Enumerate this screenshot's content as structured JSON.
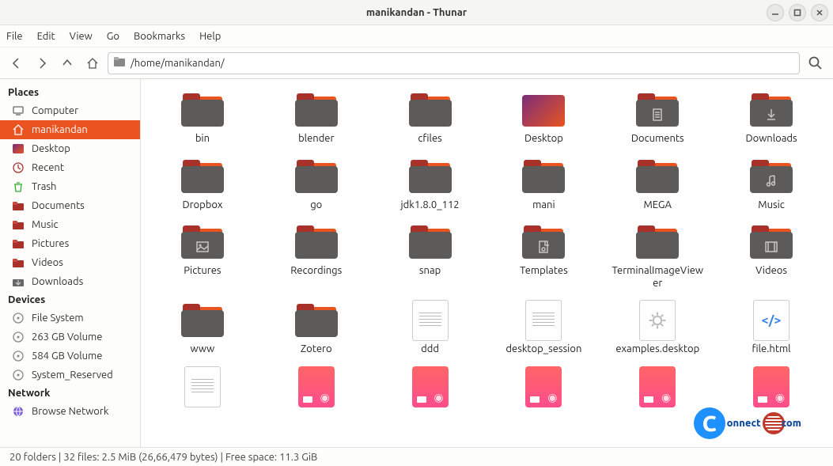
{
  "window": {
    "title": "manikandan - Thunar"
  },
  "menu": {
    "file": "File",
    "edit": "Edit",
    "view": "View",
    "go": "Go",
    "bookmarks": "Bookmarks",
    "help": "Help"
  },
  "toolbar": {
    "path": "/home/manikandan/"
  },
  "sidebar": {
    "places_header": "Places",
    "places": [
      {
        "label": "Computer",
        "icon": "computer"
      },
      {
        "label": "manikandan",
        "icon": "home",
        "active": true
      },
      {
        "label": "Desktop",
        "icon": "desktop"
      },
      {
        "label": "Recent",
        "icon": "recent"
      },
      {
        "label": "Trash",
        "icon": "trash"
      },
      {
        "label": "Documents",
        "icon": "folder-red"
      },
      {
        "label": "Music",
        "icon": "folder-red"
      },
      {
        "label": "Pictures",
        "icon": "folder-red"
      },
      {
        "label": "Videos",
        "icon": "folder-red"
      },
      {
        "label": "Downloads",
        "icon": "downloads"
      }
    ],
    "devices_header": "Devices",
    "devices": [
      {
        "label": "File System",
        "icon": "disk"
      },
      {
        "label": "263 GB Volume",
        "icon": "disk"
      },
      {
        "label": "584 GB Volume",
        "icon": "disk"
      },
      {
        "label": "System_Reserved",
        "icon": "disk"
      }
    ],
    "network_header": "Network",
    "network": [
      {
        "label": "Browse Network",
        "icon": "network"
      }
    ]
  },
  "items": [
    {
      "label": "bin",
      "type": "folder"
    },
    {
      "label": "blender",
      "type": "folder"
    },
    {
      "label": "cfiles",
      "type": "folder"
    },
    {
      "label": "Desktop",
      "type": "desktop"
    },
    {
      "label": "Documents",
      "type": "folder",
      "glyph": "doc"
    },
    {
      "label": "Downloads",
      "type": "folder",
      "glyph": "download"
    },
    {
      "label": "Dropbox",
      "type": "folder"
    },
    {
      "label": "go",
      "type": "folder"
    },
    {
      "label": "jdk1.8.0_112",
      "type": "folder"
    },
    {
      "label": "mani",
      "type": "folder"
    },
    {
      "label": "MEGA",
      "type": "folder"
    },
    {
      "label": "Music",
      "type": "folder",
      "glyph": "music"
    },
    {
      "label": "Pictures",
      "type": "folder",
      "glyph": "image"
    },
    {
      "label": "Recordings",
      "type": "folder"
    },
    {
      "label": "snap",
      "type": "folder"
    },
    {
      "label": "Templates",
      "type": "folder",
      "glyph": "template"
    },
    {
      "label": "TerminalImageViewer",
      "type": "folder"
    },
    {
      "label": "Videos",
      "type": "folder",
      "glyph": "video"
    },
    {
      "label": "www",
      "type": "folder"
    },
    {
      "label": "Zotero",
      "type": "folder"
    },
    {
      "label": "ddd",
      "type": "file-text"
    },
    {
      "label": "desktop_session",
      "type": "file-text"
    },
    {
      "label": "examples.desktop",
      "type": "file-gear"
    },
    {
      "label": "file.html",
      "type": "file-code"
    },
    {
      "label": "",
      "type": "file-text"
    },
    {
      "label": "",
      "type": "deb"
    },
    {
      "label": "",
      "type": "deb"
    },
    {
      "label": "",
      "type": "deb"
    },
    {
      "label": "",
      "type": "deb"
    },
    {
      "label": "",
      "type": "deb"
    }
  ],
  "statusbar": {
    "text": "20 folders  |  32 files: 2.5 MiB (26,66,479 bytes)  |  Free space: 11.3 GiB"
  },
  "watermark": {
    "prefix": "C",
    "rest": "onnect",
    "suffix": "com"
  }
}
